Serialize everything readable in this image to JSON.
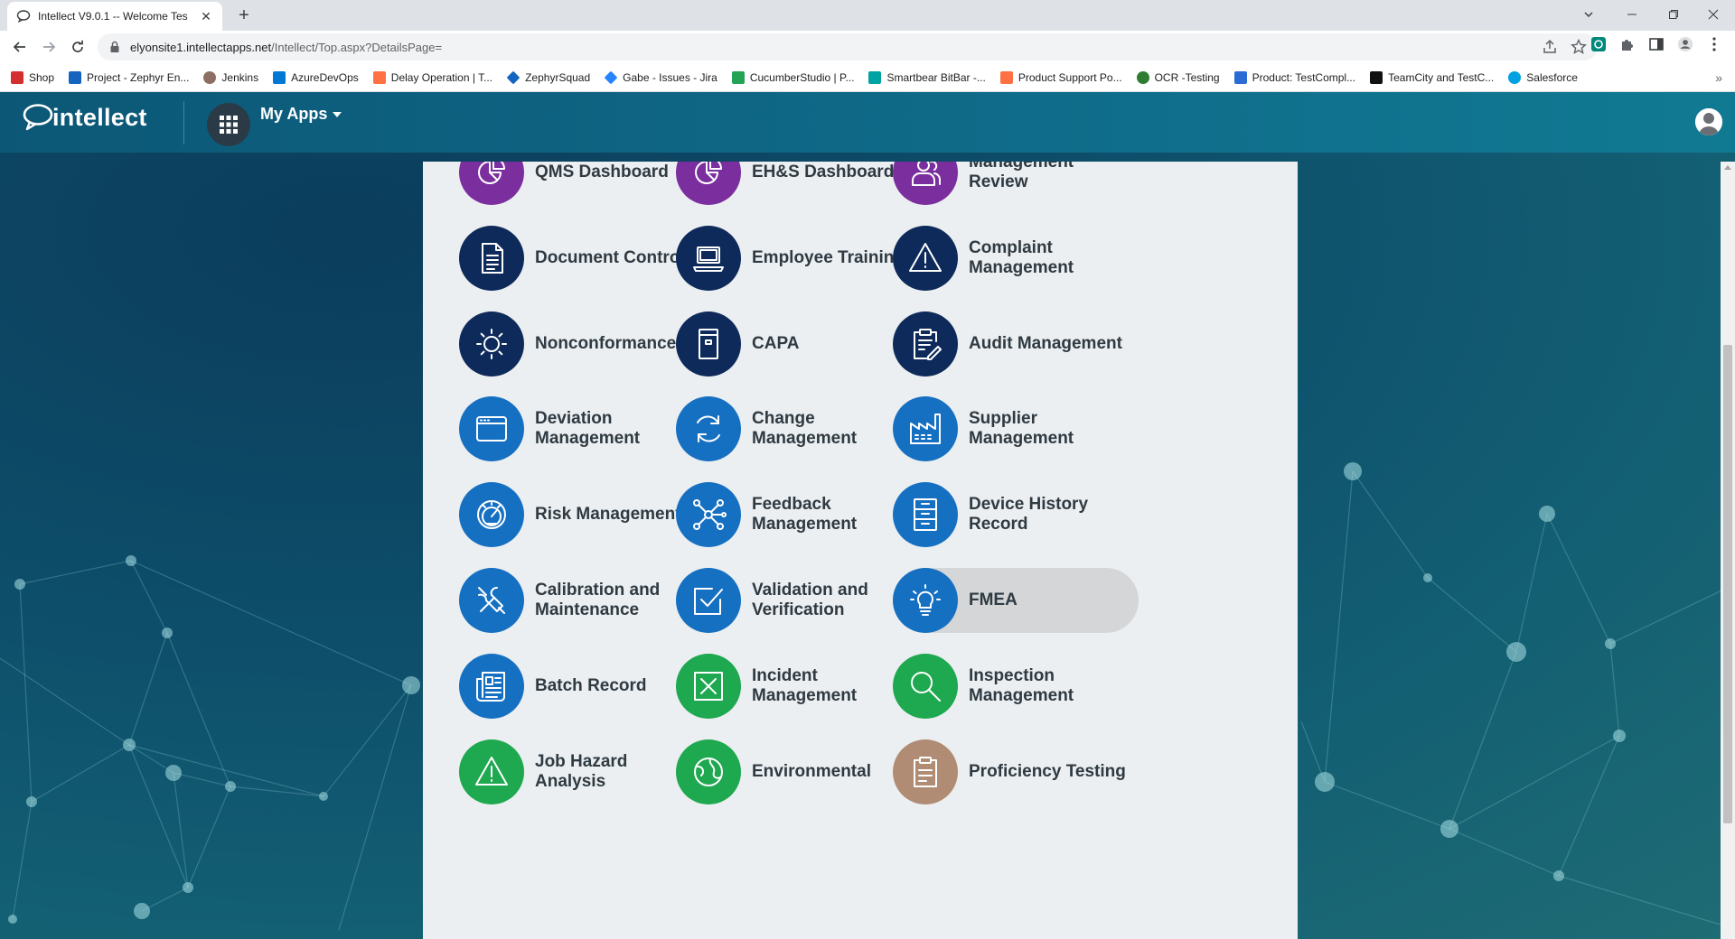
{
  "browser": {
    "tab_title": "Intellect V9.0.1 -- Welcome Tes",
    "tab_close": "✕",
    "new_tab": "+",
    "url_host": "elyonsite1.intellectapps.net",
    "url_path": "/Intellect/Top.aspx?DetailsPage=",
    "bookmarks": [
      {
        "label": "Shop",
        "color": "#d32f2f"
      },
      {
        "label": "Project - Zephyr En...",
        "color": "#1565c0"
      },
      {
        "label": "Jenkins",
        "color": "#8d6e63"
      },
      {
        "label": "AzureDevOps",
        "color": "#0078d4"
      },
      {
        "label": "Delay Operation | T...",
        "color": "#ff7043"
      },
      {
        "label": "ZephyrSquad",
        "color": "#1565c0"
      },
      {
        "label": "Gabe - Issues - Jira",
        "color": "#2684ff"
      },
      {
        "label": "CucumberStudio | P...",
        "color": "#23a455"
      },
      {
        "label": "Smartbear BitBar -...",
        "color": "#00a3a1"
      },
      {
        "label": "Product Support Po...",
        "color": "#ff7043"
      },
      {
        "label": "OCR -Testing",
        "color": "#2e7d32"
      },
      {
        "label": "Product: TestCompl...",
        "color": "#2b6cd4"
      },
      {
        "label": "TeamCity and TestC...",
        "color": "#111111"
      },
      {
        "label": "Salesforce",
        "color": "#00a1e0"
      }
    ],
    "bookmarks_more": "»"
  },
  "header": {
    "logo_text": "intellect",
    "my_apps_label": "My Apps"
  },
  "apps": [
    {
      "label": "QMS Dashboard",
      "color": "purple",
      "icon": "pie-chart-icon"
    },
    {
      "label": "EH&S Dashboard",
      "color": "purple",
      "icon": "pie-chart-icon"
    },
    {
      "label": "Management Review",
      "color": "purple",
      "icon": "people-icon"
    },
    {
      "label": "Document Control",
      "color": "navy",
      "icon": "document-icon"
    },
    {
      "label": "Employee Training",
      "color": "navy",
      "icon": "laptop-icon"
    },
    {
      "label": "Complaint Management",
      "color": "navy",
      "icon": "warning-icon"
    },
    {
      "label": "Nonconformance",
      "color": "navy",
      "icon": "sun-icon"
    },
    {
      "label": "CAPA",
      "color": "navy",
      "icon": "folder-icon"
    },
    {
      "label": "Audit Management",
      "color": "navy",
      "icon": "clipboard-pen-icon"
    },
    {
      "label": "Deviation Management",
      "color": "blue",
      "icon": "window-icon"
    },
    {
      "label": "Change Management",
      "color": "blue",
      "icon": "refresh-icon"
    },
    {
      "label": "Supplier Management",
      "color": "blue",
      "icon": "factory-icon"
    },
    {
      "label": "Risk Management",
      "color": "blue",
      "icon": "gauge-icon"
    },
    {
      "label": "Feedback Management",
      "color": "blue",
      "icon": "network-icon"
    },
    {
      "label": "Device History Record",
      "color": "blue",
      "icon": "cabinet-icon"
    },
    {
      "label": "Calibration and Maintenance",
      "color": "blue",
      "icon": "tools-icon"
    },
    {
      "label": "Validation and Verification",
      "color": "blue",
      "icon": "checkbox-icon"
    },
    {
      "label": "FMEA",
      "color": "blue",
      "icon": "lightbulb-icon"
    },
    {
      "label": "Batch Record",
      "color": "blue",
      "icon": "newspaper-icon"
    },
    {
      "label": "Incident Management",
      "color": "green",
      "icon": "x-box-icon"
    },
    {
      "label": "Inspection Management",
      "color": "green",
      "icon": "magnifier-icon"
    },
    {
      "label": "Job Hazard Analysis",
      "color": "green",
      "icon": "warning-icon"
    },
    {
      "label": "Environmental",
      "color": "green",
      "icon": "globe-icon"
    },
    {
      "label": "Proficiency Testing",
      "color": "tan",
      "icon": "clipboard-icon"
    }
  ],
  "highlighted_app": "FMEA"
}
